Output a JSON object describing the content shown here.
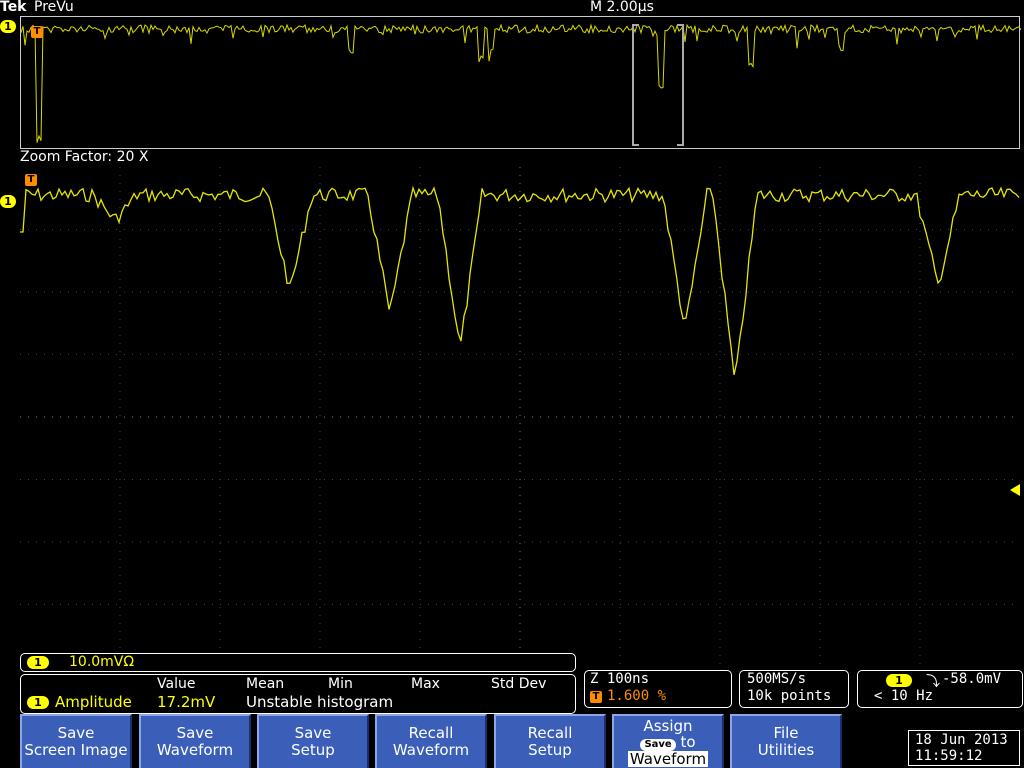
{
  "header": {
    "brand": "Tek",
    "mode": "PreVu",
    "timebase": "M 2.00µs"
  },
  "zoom": {
    "factor_label": "Zoom Factor: 20 X"
  },
  "channel": {
    "badge": "1",
    "trigger_badge": "T",
    "scale": "10.0mVΩ",
    "color": "#ffff00"
  },
  "measure": {
    "headers": [
      "Value",
      "Mean",
      "Min",
      "Max",
      "Std Dev"
    ],
    "name": "Amplitude",
    "value": "17.2mV",
    "status": "Unstable histogram"
  },
  "zoom_info": {
    "z_label": "Z 100ns",
    "trigger_pos": "1.600 %"
  },
  "acquisition": {
    "rate": "500MS/s",
    "points": "10k points"
  },
  "trigger": {
    "channel": "1",
    "slope_symbol": "⤵",
    "level": "-58.0mV",
    "freq": "< 10 Hz"
  },
  "buttons": [
    {
      "line1": "Save",
      "line2": "Screen Image"
    },
    {
      "line1": "Save",
      "line2": "Waveform"
    },
    {
      "line1": "Save",
      "line2": "Setup"
    },
    {
      "line1": "Recall",
      "line2": "Waveform"
    },
    {
      "line1": "Recall",
      "line2": "Setup"
    },
    {
      "line1": "Assign",
      "chip": "Save",
      "mid": "to",
      "line2": "Waveform"
    },
    {
      "line1": "File",
      "line2": "Utilities"
    }
  ],
  "datetime": {
    "date": "18 Jun 2013",
    "time": "11:59:12"
  },
  "colors": {
    "trace": "#e6e600",
    "button": "#3b5fb8",
    "trigger_marker": "#ff8c00"
  }
}
